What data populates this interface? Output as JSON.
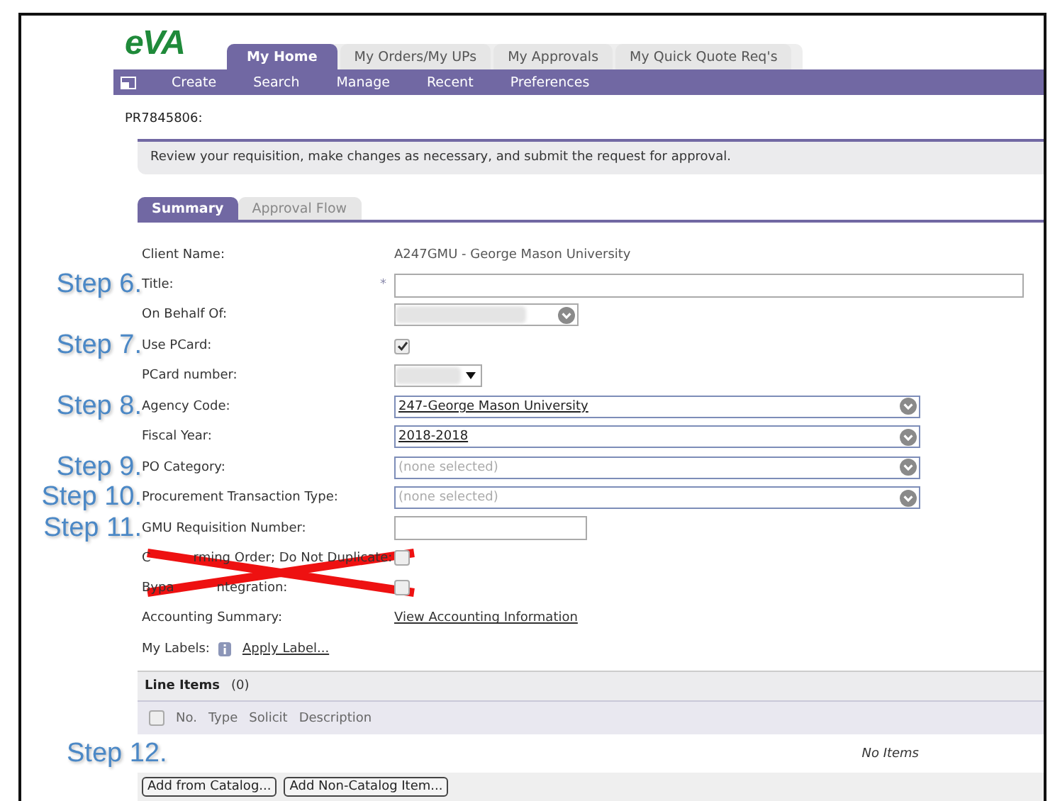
{
  "logo": "eVA",
  "top_tabs": [
    {
      "label": "My Home",
      "selected": true
    },
    {
      "label": "My Orders/My UPs",
      "selected": false
    },
    {
      "label": "My Approvals",
      "selected": false
    },
    {
      "label": "My Quick Quote Req's",
      "selected": false
    }
  ],
  "nav_menu": [
    "Create",
    "Search",
    "Manage",
    "Recent",
    "Preferences"
  ],
  "requisition_id": "PR7845806:",
  "instructions": "Review your requisition, make changes as necessary, and submit the request for approval.",
  "page_tabs": [
    {
      "label": "Summary",
      "selected": true
    },
    {
      "label": "Approval Flow",
      "selected": false
    }
  ],
  "fields": [
    {
      "label": "Client Name:",
      "kind": "text",
      "value": "A247GMU - George Mason University"
    },
    {
      "step": "Step 6.",
      "label": "Title:",
      "kind": "input",
      "required_mark": "*"
    },
    {
      "label": "On Behalf Of:",
      "kind": "redacted_select"
    },
    {
      "step": "Step 7.",
      "label": "Use PCard:",
      "kind": "checkbox",
      "checked": true
    },
    {
      "label": "PCard number:",
      "kind": "redacted_dropdown"
    },
    {
      "step": "Step 8.",
      "label": "Agency Code:",
      "kind": "select",
      "value": "247-George Mason University"
    },
    {
      "label": "Fiscal Year:",
      "kind": "select",
      "value": "2018-2018"
    },
    {
      "step": "Step 9.",
      "label": "PO Category:",
      "kind": "select",
      "placeholder": "(none selected)"
    },
    {
      "step": "Step 10.",
      "label": "Procurement Transaction Type:",
      "kind": "select",
      "placeholder": "(none selected)"
    },
    {
      "step": "Step 11.",
      "label": "GMU Requisition Number:",
      "kind": "short_input"
    },
    {
      "label_parts": [
        "C",
        "rming Order; Do Not Duplicate:"
      ],
      "kind": "checkbox",
      "checked": false,
      "crossed_out": true
    },
    {
      "label_parts": [
        "Bypa",
        "ntegration:"
      ],
      "kind": "checkbox",
      "checked": false,
      "crossed_out": true
    },
    {
      "label": "Accounting Summary:",
      "kind": "link",
      "value": "View Accounting Information"
    },
    {
      "label": "My Labels:",
      "kind": "info_link",
      "value": "Apply Label..."
    }
  ],
  "line_items": {
    "title": "Line Items",
    "count": "(0)",
    "select_all_checked": false,
    "columns": [
      "No.",
      "Type",
      "Solicit",
      "Description"
    ],
    "empty_text": "No Items",
    "step": "Step 12.",
    "buttons": [
      "Add from Catalog...",
      "Add Non-Catalog Item..."
    ]
  }
}
